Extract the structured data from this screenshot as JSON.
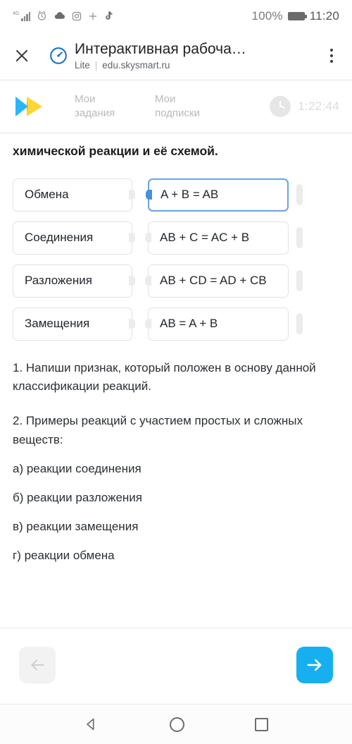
{
  "status_bar": {
    "network": "4G",
    "icons": [
      "signal-icon",
      "alarm-icon",
      "cloud-icon",
      "instagram-icon",
      "plus-icon",
      "tiktok-icon"
    ],
    "battery_percent": "100%",
    "time": "11:20"
  },
  "browser": {
    "close_label": "×",
    "page_title": "Интерактивная рабоча…",
    "mode_label": "Lite",
    "separator": "|",
    "domain": "edu.skysmart.ru",
    "menu_label": "⋮"
  },
  "appnav": {
    "logo_name": "skysmart-logo",
    "links": [
      {
        "label": "Мои задания"
      },
      {
        "label": "Мои подписки"
      }
    ],
    "timer": "1:22:44"
  },
  "task": {
    "heading": "химической реакции и её схемой.",
    "pairs": [
      {
        "left": "Обмена",
        "right": "A + B = AB",
        "selected": true
      },
      {
        "left": "Соединения",
        "right": "AB + C = AC + B",
        "selected": false
      },
      {
        "left": "Разложения",
        "right": "AB + CD = AD + CB",
        "selected": false
      },
      {
        "left": "Замещения",
        "right": "AB = A + B",
        "selected": false
      }
    ],
    "question_1": "1. Напиши признак, который положен в основу данной классификации реакций.",
    "question_2": "2. Примеры реакций с участием простых и сложных веществ:",
    "options": [
      "а) реакции соединения",
      "б) реакции разложения",
      "в) реакции замещения",
      "г) реакции обмена"
    ]
  },
  "footer": {
    "prev_icon": "arrow-left-icon",
    "next_icon": "arrow-right-icon"
  },
  "system_nav": {
    "back": "back-icon",
    "home": "home-icon",
    "recents": "recents-icon"
  },
  "colors": {
    "accent": "#16b0f0",
    "selected_border": "#6ba4dd",
    "logo_blue": "#29b6f6",
    "logo_yellow": "#ffd633"
  }
}
